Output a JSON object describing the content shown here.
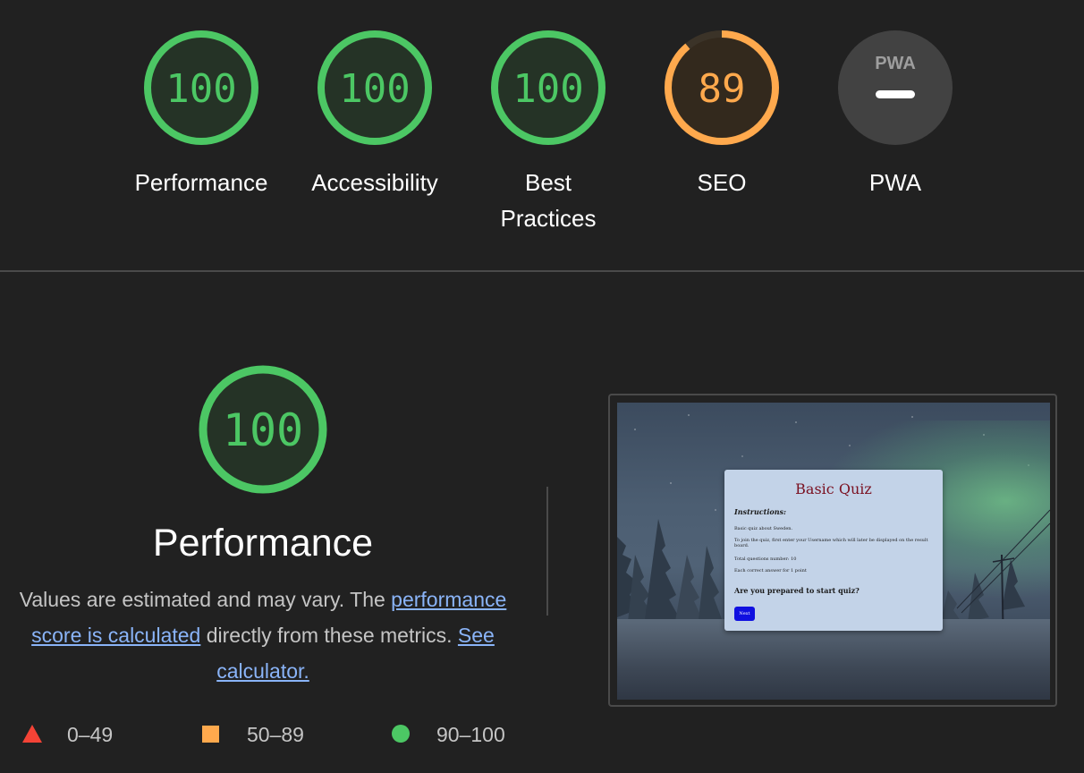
{
  "gauges": [
    {
      "label": "Performance",
      "score": "100",
      "status": "pass"
    },
    {
      "label": "Accessibility",
      "score": "100",
      "status": "pass"
    },
    {
      "label": "Best Practices",
      "score": "100",
      "status": "pass"
    },
    {
      "label": "SEO",
      "score": "89",
      "status": "average",
      "fill": 0.89
    },
    {
      "label": "PWA",
      "score": "",
      "badge": "PWA",
      "status": "na"
    }
  ],
  "performance": {
    "score": "100",
    "title": "Performance",
    "desc_before": "Values are estimated and may vary. The ",
    "link_score": "performance score is calculated",
    "desc_middle": " directly from these metrics. ",
    "link_calculator": "See calculator."
  },
  "legend": [
    {
      "range": "0–49",
      "shape": "triangle"
    },
    {
      "range": "50–89",
      "shape": "square"
    },
    {
      "range": "90–100",
      "shape": "circle"
    }
  ],
  "colors": {
    "pass": "#4cc764",
    "average": "#ffa94d",
    "fail": "#f44336",
    "link": "#8ab4f8",
    "background": "#212121"
  },
  "screenshot": {
    "title": "Basic Quiz",
    "instructions": "Instructions:",
    "lines": [
      "Basic quiz about Sweden.",
      "To join the quiz, first enter your Username which will later be displayed on the result board.",
      "Total questions number: 10",
      "Each correct answer for 1 point"
    ],
    "question": "Are you prepared to start quiz?",
    "button": "Next"
  }
}
